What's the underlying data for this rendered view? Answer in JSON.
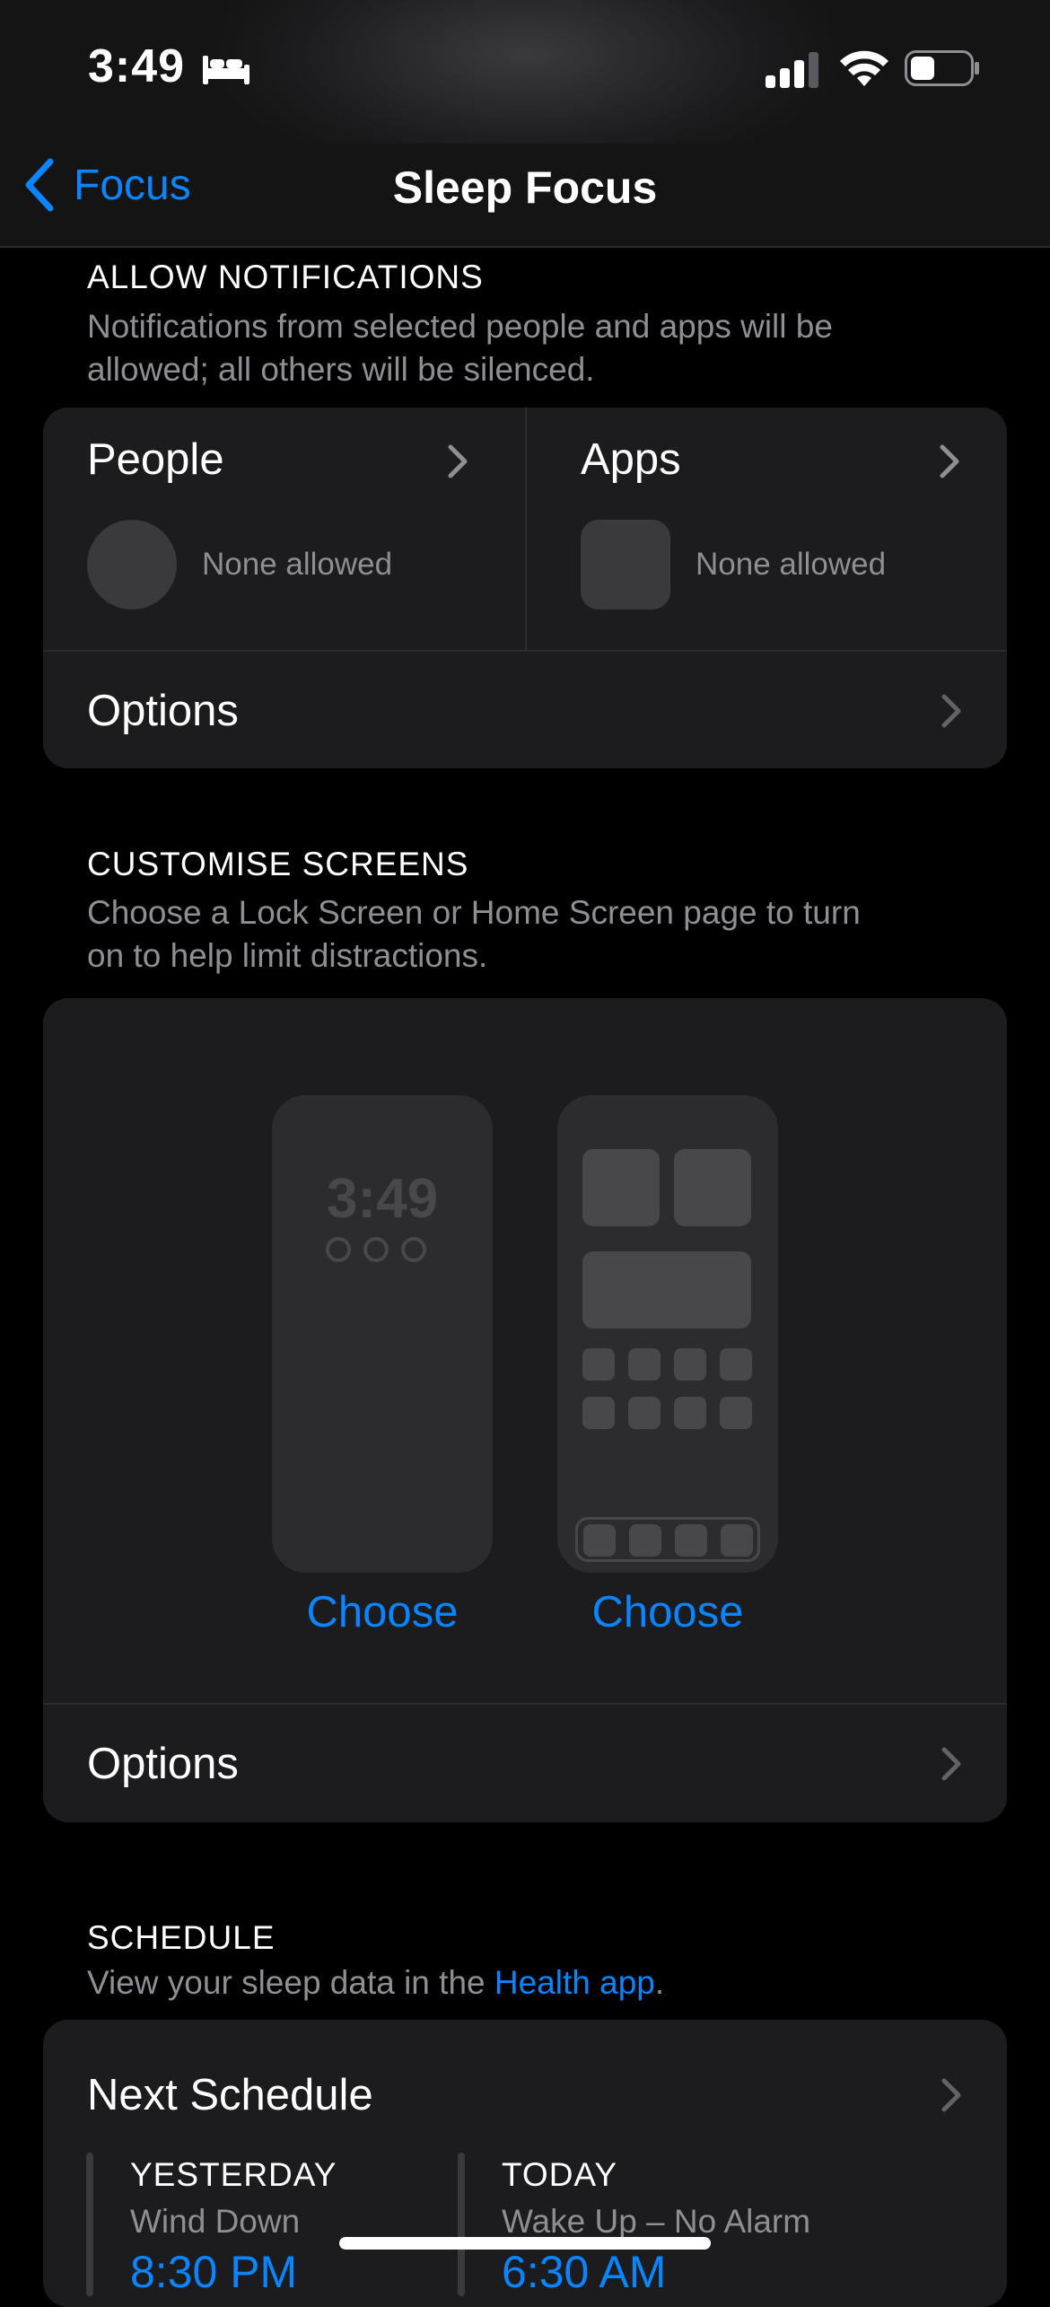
{
  "status": {
    "time": "3:49"
  },
  "nav": {
    "back_label": "Focus",
    "title": "Sleep Focus"
  },
  "allow": {
    "heading": "ALLOW NOTIFICATIONS",
    "sub_line1": "Notifications from selected people and apps will be",
    "sub_line2": "allowed; all others will be silenced.",
    "people_label": "People",
    "people_value": "None allowed",
    "apps_label": "Apps",
    "apps_value": "None allowed",
    "options_label": "Options"
  },
  "customise": {
    "heading": "CUSTOMISE SCREENS",
    "sub_line1": "Choose a Lock Screen or Home Screen page to turn",
    "sub_line2": "on to help limit distractions.",
    "lock_preview_time": "3:49",
    "lock_choose": "Choose",
    "home_choose": "Choose",
    "options_label": "Options"
  },
  "schedule": {
    "heading": "SCHEDULE",
    "sub_prefix": "View your sleep data in the ",
    "sub_link": "Health app",
    "sub_suffix": ".",
    "next_label": "Next Schedule",
    "left": {
      "day": "YESTERDAY",
      "kind": "Wind Down",
      "time": "8:30 PM"
    },
    "right": {
      "day": "TODAY",
      "kind": "Wake Up – No Alarm",
      "time": "6:30 AM"
    }
  },
  "colors": {
    "accent": "#0a84ff",
    "card": "#1c1c1e",
    "background": "#000000"
  }
}
